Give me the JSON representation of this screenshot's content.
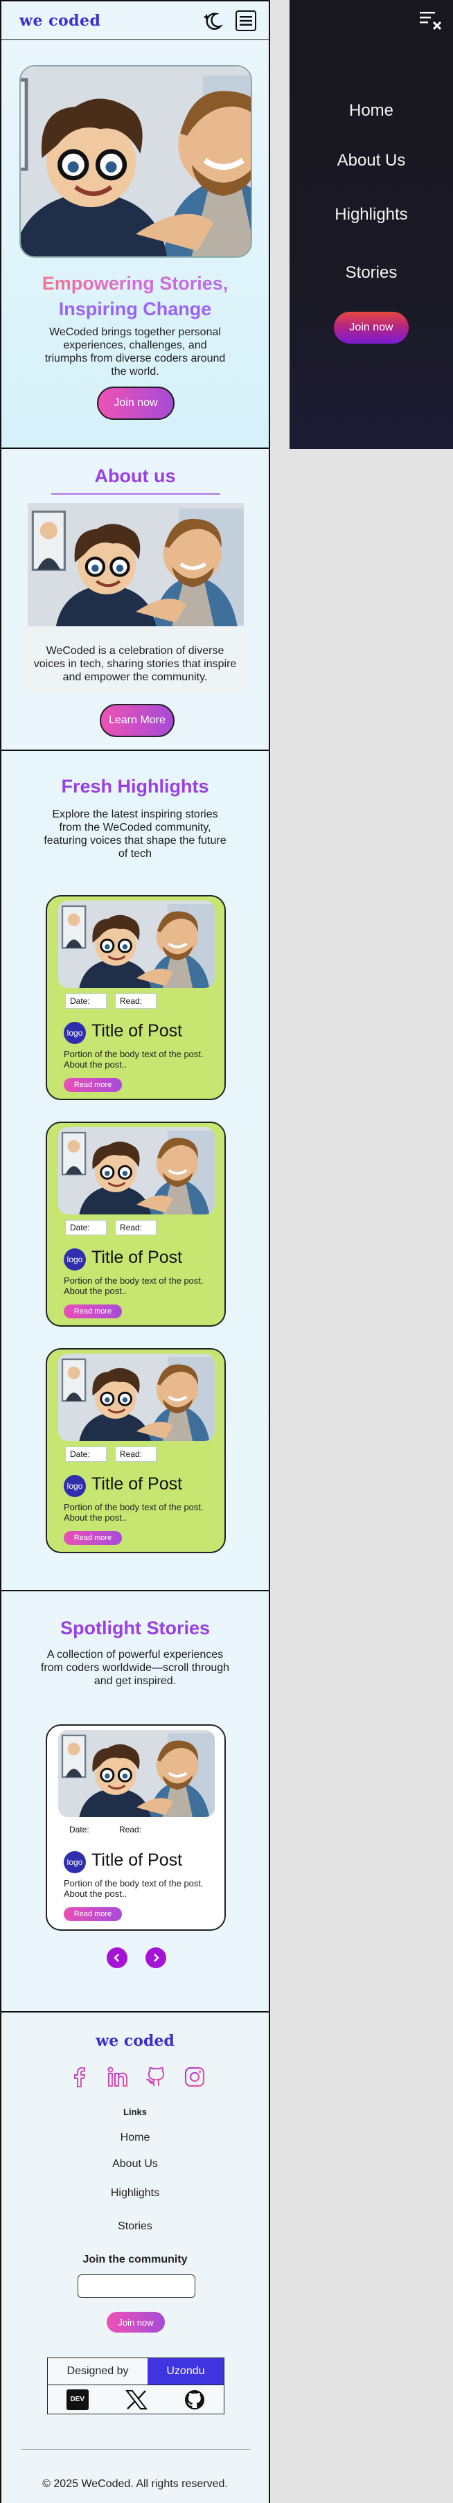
{
  "header": {
    "logo": "we coded",
    "theme_icon": "moon-icon",
    "menu_icon": "menu-icon"
  },
  "hero": {
    "title_line1": "Empowering Stories,",
    "title_line2": "Inspiring Change",
    "subtitle": "WeCoded brings together personal experiences, challenges, and triumphs from diverse coders around the world.",
    "button": "Join now"
  },
  "about": {
    "title": "About us",
    "text": "WeCoded is a celebration of diverse voices in tech, sharing stories that inspire and empower the community.",
    "button": "Learn More"
  },
  "highlights": {
    "title": "Fresh Highlights",
    "subtitle": "Explore the latest inspiring stories from the WeCoded community, featuring voices that shape the future of tech",
    "cards": [
      {
        "date": "Date:",
        "read": "Read:",
        "logo": "logo",
        "title": "Title of Post",
        "body": "Portion of the body text of the post. About the post..",
        "button": "Read more"
      },
      {
        "date": "Date:",
        "read": "Read:",
        "logo": "logo",
        "title": "Title of Post",
        "body": "Portion of the body text of the post. About the post..",
        "button": "Read more"
      },
      {
        "date": "Date:",
        "read": "Read:",
        "logo": "logo",
        "title": "Title of Post",
        "body": "Portion of the body text of the post. About the post..",
        "button": "Read more"
      }
    ]
  },
  "spotlight": {
    "title": "Spotlight Stories",
    "subtitle": "A collection of powerful experiences from coders worldwide—scroll through and get inspired.",
    "card": {
      "date": "Date:",
      "read": "Read:",
      "logo": "logo",
      "title": "Title of Post",
      "body": "Portion of the body text of the post. About the post..",
      "button": "Read more"
    },
    "prev_icon": "chevron-left-icon",
    "next_icon": "chevron-right-icon"
  },
  "footer": {
    "logo": "we coded",
    "social_icons": [
      "facebook-icon",
      "linkedin-icon",
      "github-icon",
      "instagram-icon"
    ],
    "links_heading": "Links",
    "links": [
      "Home",
      "About Us",
      "Highlights",
      "Stories"
    ],
    "join_heading": "Join the community",
    "join_placeholder": "",
    "join_button": "Join now",
    "designed_by": "Designed by",
    "designer": "Uzondu",
    "platform_icons": [
      "dev-icon",
      "x-icon",
      "github-icon"
    ],
    "dev_label": "DEV",
    "copyright": "© 2025 WeCoded. All rights reserved."
  },
  "menu": {
    "close_icon": "close-menu-icon",
    "items": [
      "Home",
      "About Us",
      "Highlights",
      "Stories"
    ],
    "button": "Join now"
  },
  "colors": {
    "brand": "#3a2fd0",
    "heading": "#9a3fe6",
    "pill_start": "#ee52b4",
    "pill_end": "#a54bd6",
    "card_lime": "#c6e571",
    "menu_bg": "#18161e",
    "designer_bg": "#3e35e0"
  }
}
